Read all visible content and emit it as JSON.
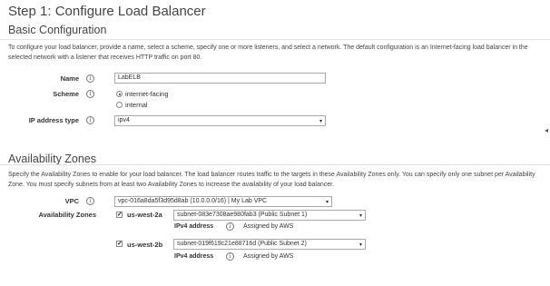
{
  "step_title": "Step 1: Configure Load Balancer",
  "basic": {
    "title": "Basic Configuration",
    "description": "To configure your load balancer, provide a name, select a scheme, specify one or more listeners, and select a network. The default configuration is an Internet-facing load balancer in the selected network with a listener that receives HTTP traffic on port 80.",
    "name_label": "Name",
    "name_value": "LabELB",
    "scheme_label": "Scheme",
    "scheme_options": [
      "internet-facing",
      "internal"
    ],
    "scheme_selected": "internet-facing",
    "ip_label": "IP address type",
    "ip_value": "ipv4"
  },
  "az": {
    "title": "Availability Zones",
    "description": "Specify the Availability Zones to enable for your load balancer. The load balancer routes traffic to the targets in these Availability Zones only. You can specify only one subnet per Availability Zone. You must specify subnets from at least two Availability Zones to increase the availability of your load balancer.",
    "vpc_label": "VPC",
    "vpc_value": "vpc-016a8da5f3d95d8ab (10.0.0.0/16) | My Lab VPC",
    "zones_label": "Availability Zones",
    "zones": [
      {
        "name": "us-west-2a",
        "checked": true,
        "subnet": "subnet-083e7308ae980fab3 (Public Subnet 1)",
        "ipv4_label": "IPv4 address",
        "ipv4_value": "Assigned by AWS"
      },
      {
        "name": "us-west-2b",
        "checked": true,
        "subnet": "subnet-019f619c21e88716d (Public Subnet 2)",
        "ipv4_label": "IPv4 address",
        "ipv4_value": "Assigned by AWS"
      }
    ]
  },
  "icons": {
    "info": "i",
    "caret": "▾",
    "check": "✓",
    "collapse": "◂"
  }
}
